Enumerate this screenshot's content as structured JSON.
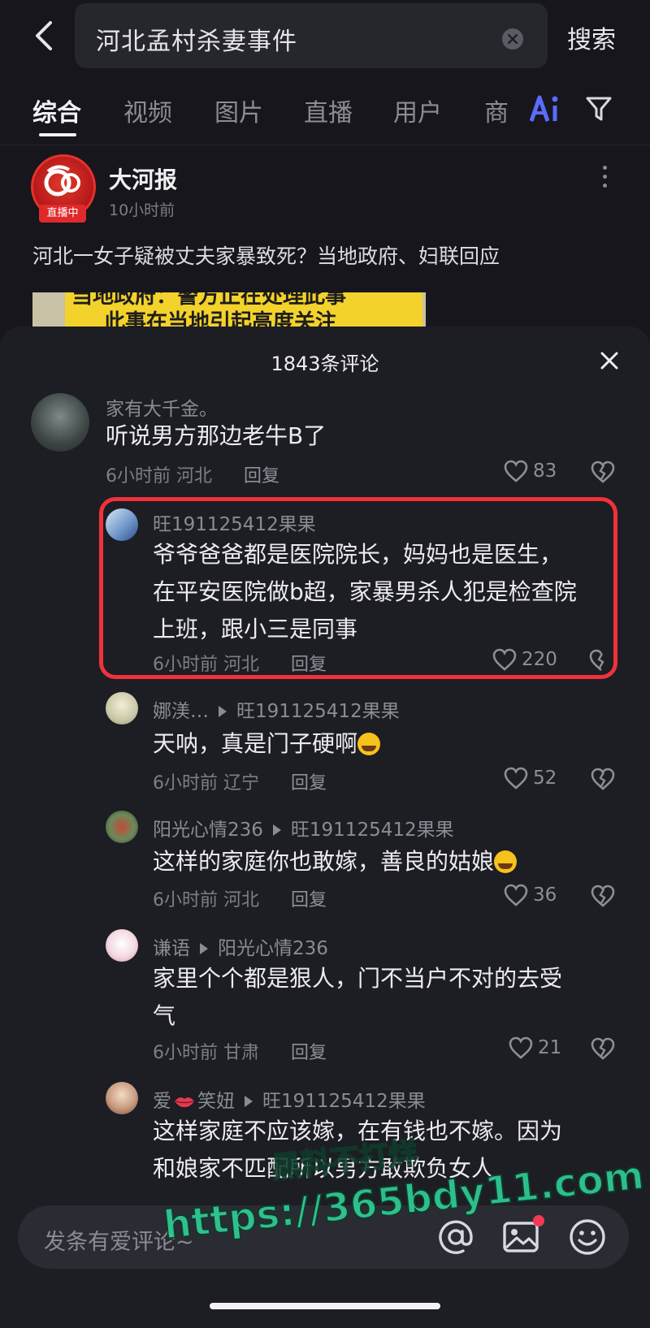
{
  "search": {
    "query": "河北孟村杀妻事件",
    "button_label": "搜索"
  },
  "tabs": [
    {
      "label": "综合",
      "active": true
    },
    {
      "label": "视频",
      "active": false
    },
    {
      "label": "图片",
      "active": false
    },
    {
      "label": "直播",
      "active": false
    },
    {
      "label": "用户",
      "active": false
    },
    {
      "label": "商",
      "active": false
    }
  ],
  "post": {
    "author": "大河报",
    "live_badge": "直播中",
    "time": "10小时前",
    "headline": "河北一女子疑被丈夫家暴致死？当地政府、妇联回应",
    "thumb_line1": "当地政府：警方正在处理此事",
    "thumb_line2": "此事在当地引起高度关注"
  },
  "comments_sheet": {
    "title": "1843条评论",
    "comments": [
      {
        "user": "家有大千金。",
        "text": "听说男方那边老牛B了",
        "time": "6小时前",
        "location": "河北",
        "reply": "回复",
        "likes": "83"
      },
      {
        "user": "旺191125412果果",
        "text_line1": "爷爷爸爸都是医院院长，妈妈也是医生，",
        "text_line2": "在平安医院做b超，家暴男杀人犯是检查院",
        "text_line3": "上班，跟小三是同事",
        "time": "6小时前",
        "location": "河北",
        "reply": "回复",
        "likes": "220"
      },
      {
        "user": "娜渼…",
        "reply_to": "旺191125412果果",
        "text": "天呐，真是门子硬啊",
        "time": "6小时前",
        "location": "辽宁",
        "reply": "回复",
        "likes": "52"
      },
      {
        "user": "阳光心情236",
        "reply_to": "旺191125412果果",
        "text": "这样的家庭你也敢嫁，善良的姑娘",
        "time": "6小时前",
        "location": "河北",
        "reply": "回复",
        "likes": "36"
      },
      {
        "user": "谦语",
        "reply_to": "阳光心情236",
        "text_line1": "家里个个都是狠人，门不当户不对的去受",
        "text_line2": "气",
        "time": "6小时前",
        "location": "甘肃",
        "reply": "回复",
        "likes": "21"
      },
      {
        "user_part1": "爱",
        "user_part2": "笑妞",
        "reply_to": "旺191125412果果",
        "text_line1": "这样家庭不应该嫁，在有钱也不嫁。因为",
        "text_line2": "和娘家不匹配所以男方敢欺负女人"
      }
    ]
  },
  "input": {
    "placeholder": "发条有爱评论~"
  },
  "watermark": {
    "line1": "黑料不打烊",
    "line2": "https://365bdy11.com"
  },
  "colors": {
    "background": "#16161c",
    "sheet": "#1d1d24",
    "highlight": "#f0323b",
    "ai_icon": "#5b6bff"
  }
}
